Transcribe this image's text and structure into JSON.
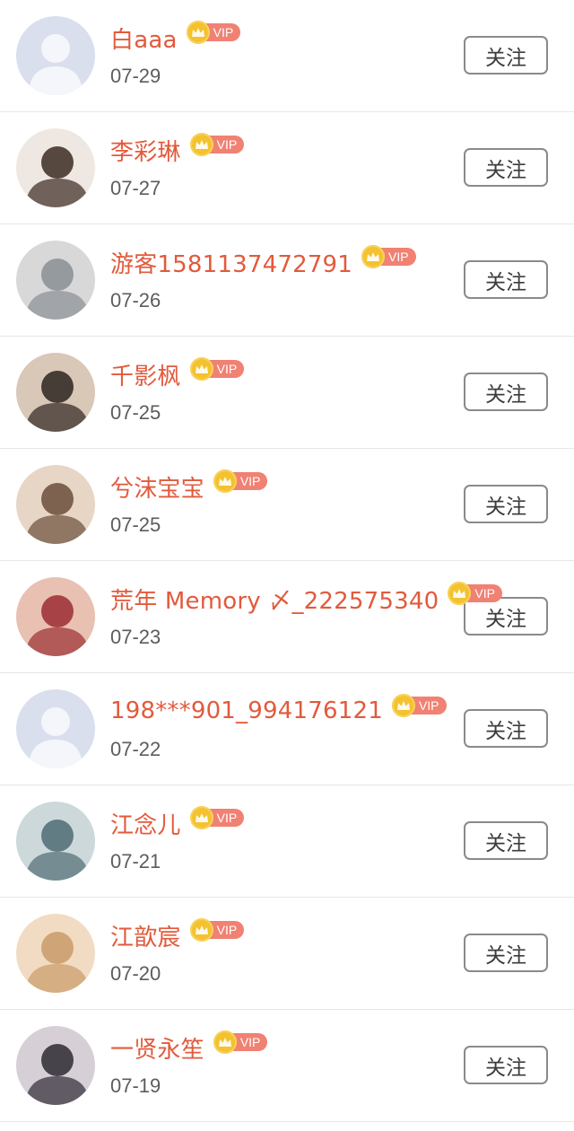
{
  "colors": {
    "name": "#e25a3c",
    "vip_tag": "#f08173",
    "crown": "#f4c22f",
    "date": "#5c5c5c"
  },
  "vip_label": "VIP",
  "follow_label": "关注",
  "users": [
    {
      "name": "白aaa",
      "date": "07-29",
      "avatar": "default-avatar"
    },
    {
      "name": "李彩琳",
      "date": "07-27",
      "avatar": "photo-avatar"
    },
    {
      "name": "游客1581137472791",
      "date": "07-26",
      "avatar": "photo-avatar"
    },
    {
      "name": "千影枫",
      "date": "07-25",
      "avatar": "photo-avatar"
    },
    {
      "name": "兮沫宝宝",
      "date": "07-25",
      "avatar": "photo-avatar"
    },
    {
      "name": "荒年 Memory 〆_222575340",
      "date": "07-23",
      "avatar": "photo-avatar"
    },
    {
      "name": "198***901_994176121",
      "date": "07-22",
      "avatar": "default-avatar"
    },
    {
      "name": "江念儿",
      "date": "07-21",
      "avatar": "photo-avatar"
    },
    {
      "name": "江歆宸",
      "date": "07-20",
      "avatar": "photo-avatar"
    },
    {
      "name": "一贤永笙",
      "date": "07-19",
      "avatar": "photo-avatar"
    }
  ]
}
